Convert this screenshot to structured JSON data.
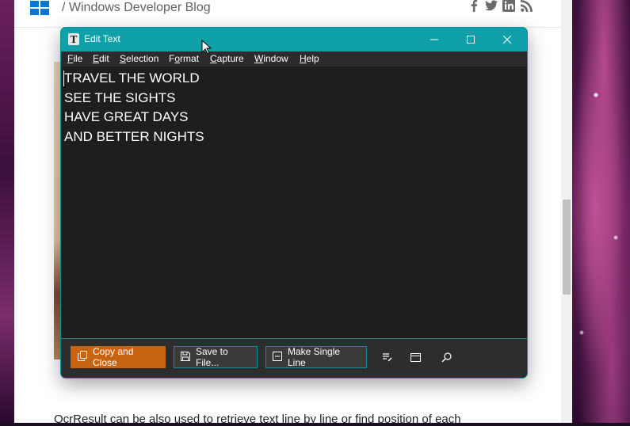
{
  "page": {
    "blog_title": "/ Windows Developer Blog",
    "paragraph_text": "OcrResult can be also used to retrieve text line by line or find position of each",
    "social_icons": [
      "facebook-icon",
      "twitter-icon",
      "linkedin-icon",
      "rss-icon"
    ]
  },
  "window": {
    "title": "Edit Text",
    "app_icon_glyph": "T",
    "controls": {
      "minimize": "—",
      "maximize": "☐",
      "close": "✕"
    },
    "menu": [
      {
        "pre": "",
        "key": "F",
        "post": "ile"
      },
      {
        "pre": "",
        "key": "E",
        "post": "dit"
      },
      {
        "pre": "",
        "key": "S",
        "post": "election"
      },
      {
        "pre": "F",
        "key": "o",
        "post": "rmat"
      },
      {
        "pre": "",
        "key": "C",
        "post": "apture"
      },
      {
        "pre": "",
        "key": "W",
        "post": "indow"
      },
      {
        "pre": "",
        "key": "H",
        "post": "elp"
      }
    ],
    "editor_text": "TRAVEL THE WORLD\nSEE THE SIGHTS\nHAVE GREAT DAYS\nAND BETTER NIGHTS",
    "bottom_buttons": {
      "copy_close": "Copy and Close",
      "save_file": "Save to File...",
      "single_line": "Make Single Line"
    },
    "bottom_icons": [
      "edit-list-icon",
      "window-icon",
      "search-icon"
    ]
  },
  "colors": {
    "titlebar": "#0fa0a9",
    "accent_button": "#c86411",
    "editor_bg": "#1e1e1e",
    "windows_blue": "#0078d4"
  }
}
